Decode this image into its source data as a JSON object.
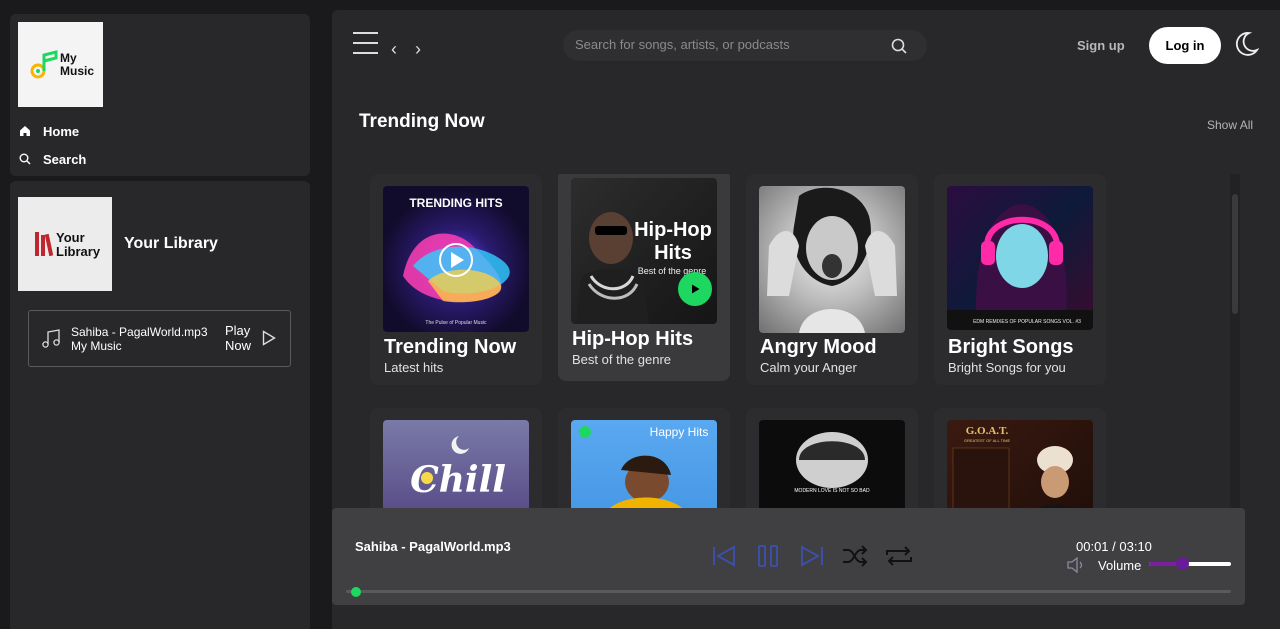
{
  "sidebar": {
    "logo_text_1": "My",
    "logo_text_2": "Music",
    "nav": [
      {
        "label": "Home",
        "icon": "home-icon"
      },
      {
        "label": "Search",
        "icon": "search-icon"
      }
    ],
    "library": {
      "logo_text_1": "Your",
      "logo_text_2": "Library",
      "title": "Your Library"
    },
    "now_playing_card": {
      "song": "Sahiba - PagalWorld.mp3",
      "artist": "My Music",
      "play_label_1": "Play",
      "play_label_2": "Now"
    }
  },
  "header": {
    "search_placeholder": "Search for songs, artists, or podcasts",
    "signup_label": "Sign up",
    "login_label": "Log in"
  },
  "trending": {
    "title": "Trending Now",
    "show_all_label": "Show All",
    "cards": [
      {
        "title": "Trending Now",
        "subtitle": "Latest hits",
        "art_text": "TRENDING HITS",
        "art_caption": "The Pulse of Popular Music"
      },
      {
        "title": "Hip-Hop Hits",
        "subtitle": "Best of the genre",
        "art_text_1": "Hip-Hop",
        "art_text_2": "Hits",
        "art_caption": "Best of the genre"
      },
      {
        "title": "Angry Mood",
        "subtitle": "Calm your Anger"
      },
      {
        "title": "Bright Songs",
        "subtitle": "Bright Songs for you",
        "art_caption": "EDM REMIXES OF POPULAR SONGS VOL. #3"
      },
      {
        "title": "",
        "subtitle": "",
        "art_text": "Chill"
      },
      {
        "title": "",
        "subtitle": "",
        "art_text": "Happy Hits"
      },
      {
        "title": "",
        "subtitle": "",
        "art_caption": "MODERN LOVE IS NOT SO BAD"
      },
      {
        "title": "",
        "subtitle": "",
        "art_text": "G.O.A.T.",
        "art_caption": "GREATEST OF ALL TIME"
      }
    ]
  },
  "player": {
    "song": "Sahiba - PagalWorld.mp3",
    "time": "00:01 / 03:10",
    "volume_label": "Volume",
    "volume_level": 0.4,
    "progress": 0.005
  },
  "colors": {
    "accent_green": "#1ed760",
    "volume_purple": "#7a1fa2",
    "control_blue": "#3b4fa8"
  }
}
